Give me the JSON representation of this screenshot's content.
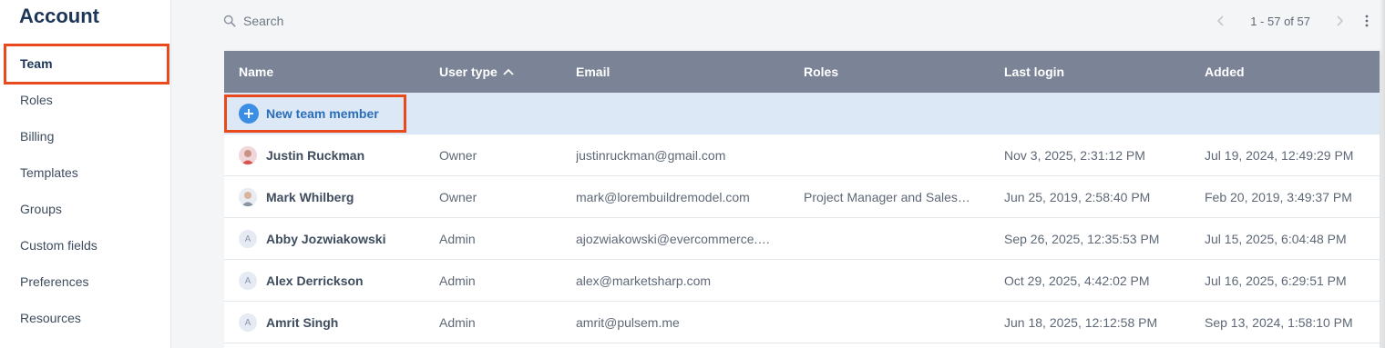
{
  "sidebar": {
    "title": "Account",
    "items": [
      {
        "label": "Team",
        "active": true
      },
      {
        "label": "Roles"
      },
      {
        "label": "Billing"
      },
      {
        "label": "Templates"
      },
      {
        "label": "Groups"
      },
      {
        "label": "Custom fields"
      },
      {
        "label": "Preferences"
      },
      {
        "label": "Resources"
      }
    ]
  },
  "search": {
    "placeholder": "Search",
    "value": "",
    "icon": "search-icon"
  },
  "pagination": {
    "range": "1 - 57 of 57"
  },
  "table": {
    "columns": [
      "Name",
      "User type",
      "Email",
      "Roles",
      "Last login",
      "Added"
    ],
    "sort_column": "User type",
    "sort_direction": "ascending",
    "new_member_label": "New team member",
    "rows": [
      {
        "avatar": "photo",
        "avatar_initial": "",
        "name": "Justin Ruckman",
        "user_type": "Owner",
        "email": "justinruckman@gmail.com",
        "roles": "",
        "last_login": "Nov 3, 2025, 2:31:12 PM",
        "added": "Jul 19, 2024, 12:49:29 PM"
      },
      {
        "avatar": "photo",
        "avatar_initial": "",
        "name": "Mark Whilberg",
        "user_type": "Owner",
        "email": "mark@lorembuildremodel.com",
        "roles": "Project Manager and Sales…",
        "last_login": "Jun 25, 2019, 2:58:40 PM",
        "added": "Feb 20, 2019, 3:49:37 PM"
      },
      {
        "avatar": "initial",
        "avatar_initial": "A",
        "name": "Abby Jozwiakowski",
        "user_type": "Admin",
        "email": "ajozwiakowski@evercommerce.…",
        "roles": "",
        "last_login": "Sep 26, 2025, 12:35:53 PM",
        "added": "Jul 15, 2025, 6:04:48 PM"
      },
      {
        "avatar": "initial",
        "avatar_initial": "A",
        "name": "Alex Derrickson",
        "user_type": "Admin",
        "email": "alex@marketsharp.com",
        "roles": "",
        "last_login": "Oct 29, 2025, 4:42:02 PM",
        "added": "Jul 16, 2025, 6:29:51 PM"
      },
      {
        "avatar": "initial",
        "avatar_initial": "A",
        "name": "Amrit Singh",
        "user_type": "Admin",
        "email": "amrit@pulsem.me",
        "roles": "",
        "last_login": "Jun 18, 2025, 12:12:58 PM",
        "added": "Sep 13, 2024, 1:58:10 PM"
      }
    ]
  },
  "colors": {
    "header_bg": "#7b8396",
    "new_row_bg": "#dce8f5",
    "accent_blue": "#3b8ee3",
    "highlight": "#e8491d",
    "title": "#1d3557"
  }
}
